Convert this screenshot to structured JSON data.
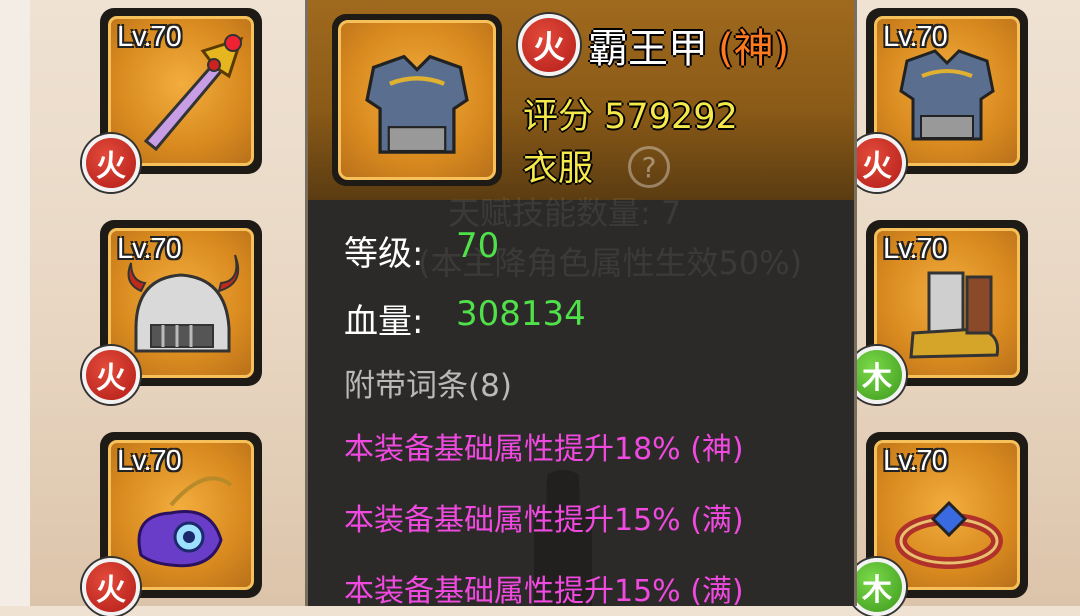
{
  "slots_left": [
    {
      "level": "Lv.70",
      "element": "火",
      "item": "sword"
    },
    {
      "level": "Lv.70",
      "element": "火",
      "item": "helmet"
    },
    {
      "level": "Lv.70",
      "element": "火",
      "item": "amulet"
    }
  ],
  "slots_right": [
    {
      "level": "Lv.70",
      "element": "火",
      "item": "armor"
    },
    {
      "level": "Lv.70",
      "element": "木",
      "item": "boots"
    },
    {
      "level": "Lv.70",
      "element": "木",
      "item": "ring"
    }
  ],
  "tooltip": {
    "element": "火",
    "name": "霸王甲",
    "grade": "(神)",
    "score_label": "评分",
    "score_value": "579292",
    "category": "衣服",
    "help": "?",
    "level_label": "等级:",
    "level_value": "70",
    "hp_label": "血量:",
    "hp_value": "308134",
    "affix_header": "附带词条(8)",
    "affixes": [
      "本装备基础属性提升18% (神)",
      "本装备基础属性提升15% (满)",
      "本装备基础属性提升15% (满)"
    ],
    "background_text": [
      "天赋技能数量: 7",
      "(本主降角色属性生效50%)"
    ]
  },
  "colors": {
    "fire": "#c8261f",
    "wood": "#53b32c",
    "affix": "#f049e0",
    "stat_value": "#4fe04a",
    "score": "#f5e84a",
    "grade": "#ff7a1f"
  }
}
